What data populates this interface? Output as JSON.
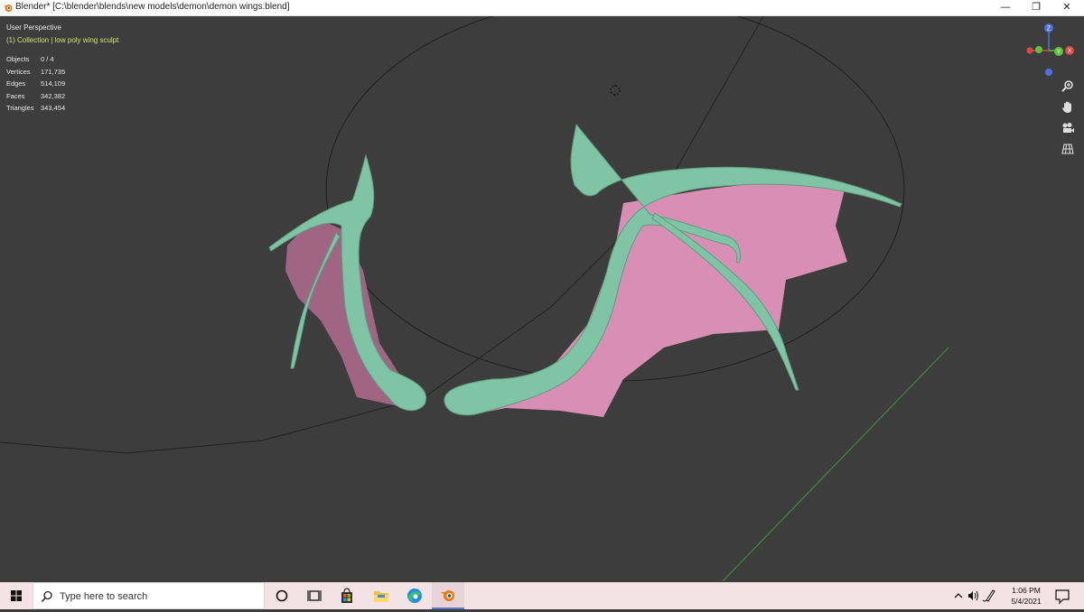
{
  "window": {
    "title": "Blender* [C:\\blender\\blends\\new models\\demon\\demon wings.blend]",
    "minimize_glyph": "—",
    "restore_glyph": "❐",
    "close_glyph": "✕"
  },
  "viewport": {
    "view_name": "User Perspective",
    "collection_info": "(1) Collection | low poly wing sculpt",
    "stats": [
      {
        "label": "Objects",
        "value": "0 / 4"
      },
      {
        "label": "Vertices",
        "value": "171,735"
      },
      {
        "label": "Edges",
        "value": "514,109"
      },
      {
        "label": "Faces",
        "value": "342,382"
      },
      {
        "label": "Triangles",
        "value": "343,454"
      }
    ],
    "gizmo": {
      "z_label": "Z",
      "y_label": "Y",
      "x_label": "X"
    },
    "colors": {
      "background": "#3d3d3d",
      "wing_bone": "#7fc4a4",
      "wing_membrane": "#d98fb3",
      "axis_x": "#e04848",
      "axis_y": "#5fc23a",
      "axis_z": "#4d6fe0",
      "overlay_text": "#d2e26e"
    }
  },
  "taskbar": {
    "search_placeholder": "Type here to search",
    "time": "1:06 PM",
    "date": "5/4/2021"
  }
}
